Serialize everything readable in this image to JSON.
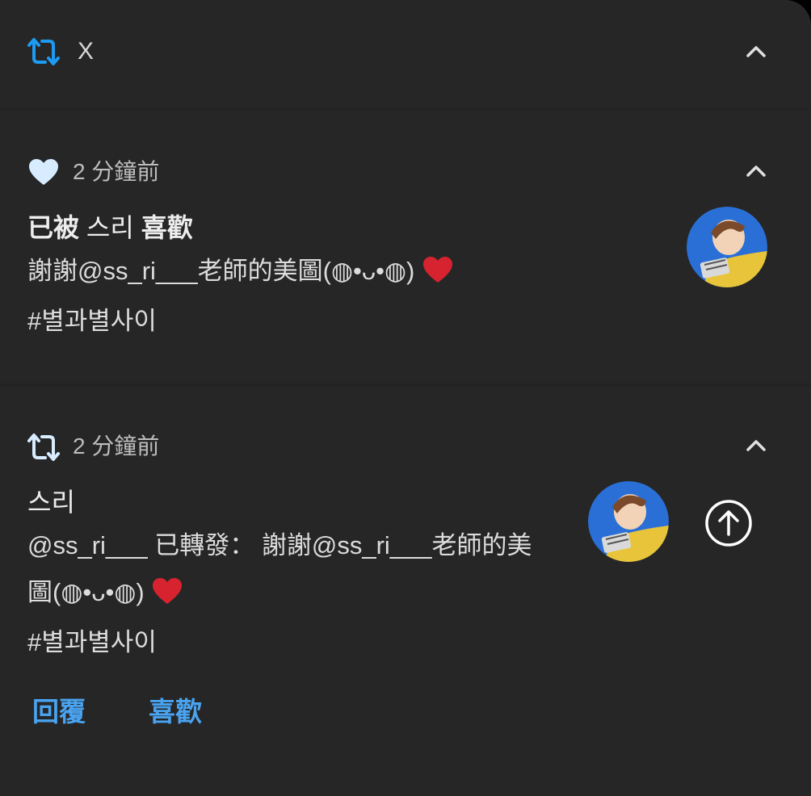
{
  "app": {
    "name": "X",
    "accent_color": "#1d9bf0",
    "link_color": "#4aa3f0"
  },
  "notifications": [
    {
      "type_icon": "heart-icon",
      "time": "2 分鐘前",
      "title_prefix": "已被",
      "title_user": "스리",
      "title_suffix": "喜歡",
      "text_line1": "謝謝@ss_ri___老師的美圖(◍•ᴗ•◍)",
      "hashtag": " #별과별사이",
      "avatar": "user-avatar"
    },
    {
      "type_icon": "retweet-icon",
      "time": "2 分鐘前",
      "title": "스리",
      "text_line1": "@ss_ri___ 已轉發： 謝謝@ss_ri___老師的美",
      "text_line2": "圖(◍•ᴗ•◍)",
      "hashtag": " #별과별사이",
      "avatar": "user-avatar"
    }
  ],
  "actions": {
    "reply": "回覆",
    "like": "喜歡"
  }
}
